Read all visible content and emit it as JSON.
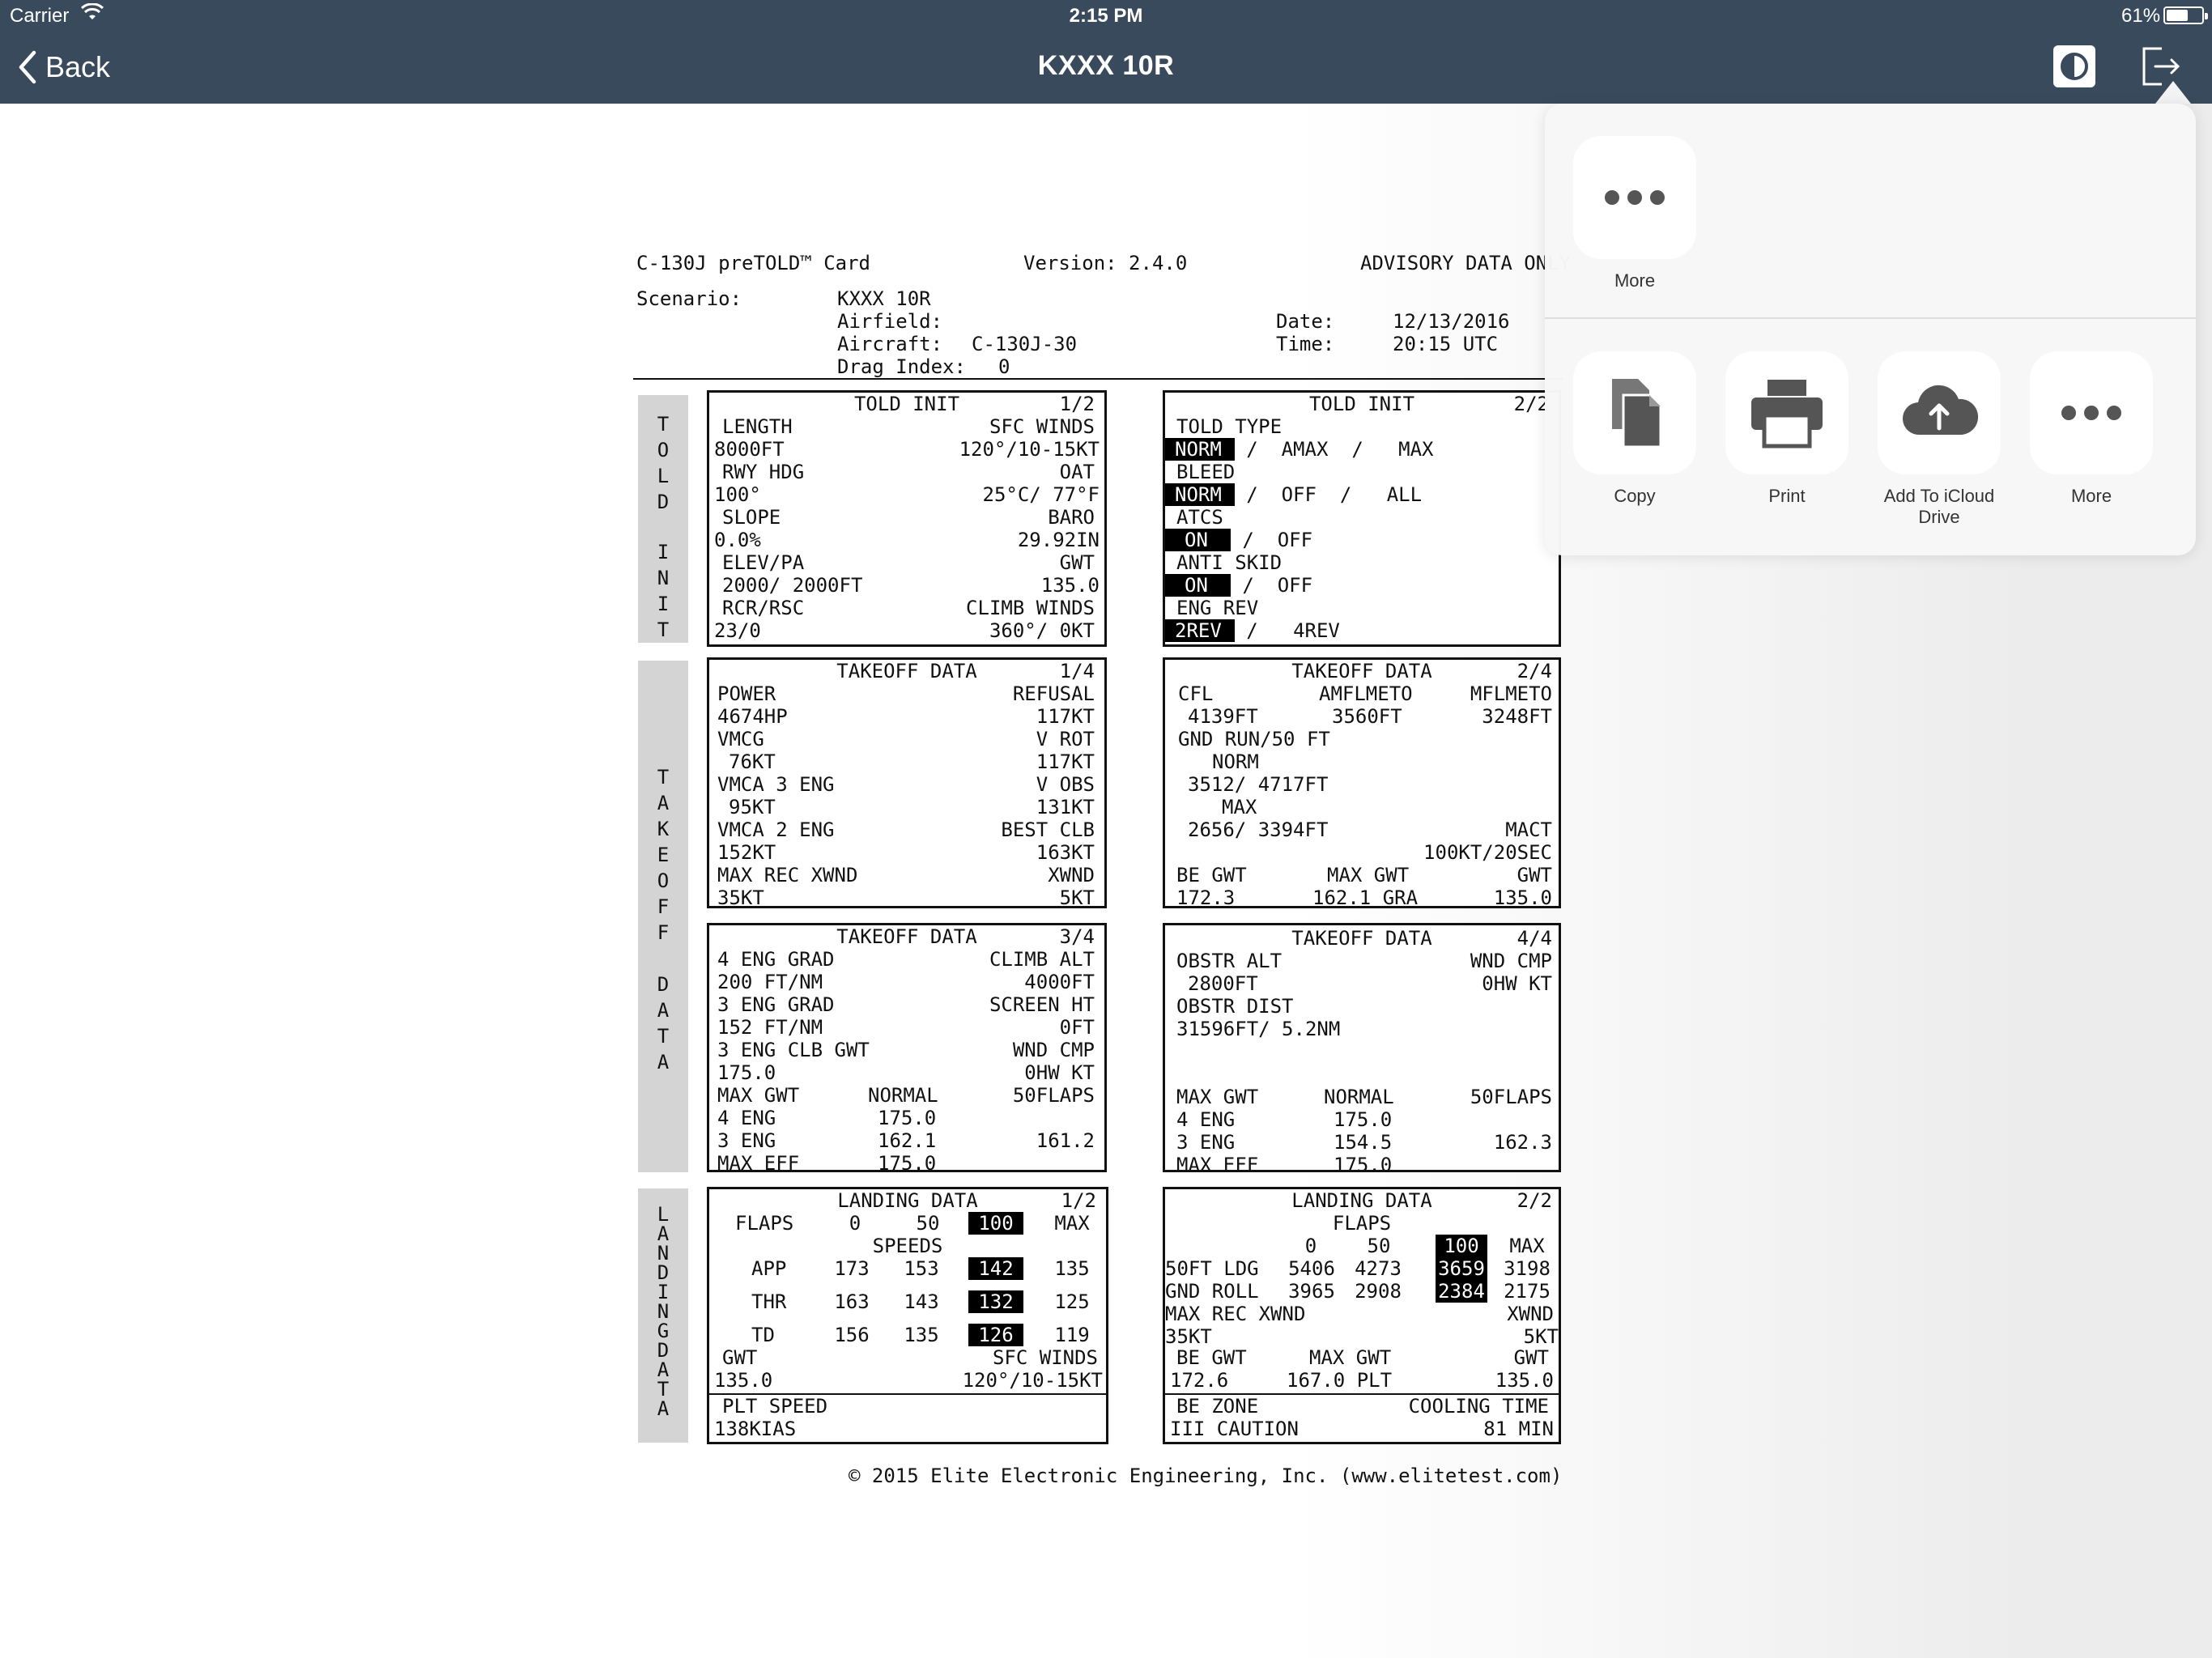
{
  "status_bar": {
    "carrier": "Carrier",
    "time": "2:15 PM",
    "battery": "61%",
    "battery_level": 0.61
  },
  "nav": {
    "back_label": "Back",
    "title": "KXXX 10R"
  },
  "doc": {
    "header": {
      "card_title": "C-130J preTOLD™ Card",
      "version": "Version: 2.4.0",
      "advisory": "ADVISORY DATA ONLY",
      "scenario_label": "Scenario:",
      "scenario_value": "KXXX 10R",
      "airfield_label": "Airfield:",
      "aircraft_label": "Aircraft:",
      "aircraft_value": "C-130J-30",
      "drag_label": "Drag Index:",
      "drag_value": "0",
      "date_label": "Date:",
      "date_value": "12/13/2016",
      "time_label": "Time:",
      "time_value": "20:15 UTC"
    },
    "side_tabs": {
      "told_init": [
        "T",
        "O",
        "L",
        "D",
        "",
        "I",
        "N",
        "I",
        "T"
      ],
      "takeoff": [
        "T",
        "A",
        "K",
        "E",
        "O",
        "F",
        "F",
        "",
        "D",
        "A",
        "T",
        "A"
      ],
      "landing": [
        "L",
        "A",
        "N",
        "D",
        "I",
        "N",
        "G",
        "D",
        "A",
        "T",
        "A"
      ]
    },
    "told_init_1": {
      "title": "TOLD INIT",
      "page": "1/2",
      "length_label": "LENGTH",
      "length": "8000FT",
      "sfc_winds_label": "SFC WINDS",
      "sfc_winds": "120°/10-15KT",
      "rwy_hdg_label": "RWY HDG",
      "rwy_hdg": "100°",
      "oat_label": "OAT",
      "oat": "25°C/ 77°F",
      "slope_label": "SLOPE",
      "slope": "0.0%",
      "baro_label": "BARO",
      "baro": "29.92IN",
      "elev_label": "ELEV/PA",
      "elev": "2000/ 2000FT",
      "gwt_label": "GWT",
      "gwt": "135.0",
      "rcr_label": "RCR/RSC",
      "rcr": "23/0",
      "climb_winds_label": "CLIMB WINDS",
      "climb_winds": "360°/ 0KT"
    },
    "told_init_2": {
      "title": "TOLD INIT",
      "page": "2/2",
      "told_type_label": "TOLD TYPE",
      "told_type": [
        "NORM",
        "/",
        "AMAX",
        "/",
        "MAX"
      ],
      "bleed_label": "BLEED",
      "bleed": [
        "NORM",
        "/",
        "OFF",
        "/",
        "ALL"
      ],
      "atcs_label": "ATCS",
      "atcs": [
        "ON",
        "/",
        "OFF"
      ],
      "anti_skid_label": "ANTI SKID",
      "anti_skid": [
        "ON",
        "/",
        "OFF"
      ],
      "eng_rev_label": "ENG REV",
      "eng_rev": [
        "2REV",
        "/",
        "4REV"
      ]
    },
    "takeoff_1": {
      "title": "TAKEOFF DATA",
      "page": "1/4",
      "power_label": "POWER",
      "power": "4674HP",
      "refusal_label": "REFUSAL",
      "refusal": "117KT",
      "vmcg_label": "VMCG",
      "vmcg": "76KT",
      "vrot_label": "V ROT",
      "vrot": "117KT",
      "vmca3_label": "VMCA 3 ENG",
      "vmca3": "95KT",
      "vobs_label": "V OBS",
      "vobs": "131KT",
      "vmca2_label": "VMCA 2 ENG",
      "vmca2": "152KT",
      "best_clb_label": "BEST CLB",
      "best_clb": "163KT",
      "max_rec_xwnd_label": "MAX REC XWND",
      "max_rec_xwnd": "35KT",
      "xwnd_label": "XWND",
      "xwnd": "5KT"
    },
    "takeoff_2": {
      "title": "TAKEOFF DATA",
      "page": "2/4",
      "cfl_label": "CFL",
      "cfl": "4139FT",
      "amflmeto_label": "AMFLMETO",
      "amflmeto": "3560FT",
      "mflmeto_label": "MFLMETO",
      "mflmeto": "3248FT",
      "gnd_run_label": "GND RUN/50 FT",
      "norm_label": "NORM",
      "norm": "3512/ 4717FT",
      "max_label": "MAX",
      "max": "2656/ 3394FT",
      "mact_label": "MACT",
      "mact": "100KT/20SEC",
      "be_gwt_label": "BE GWT",
      "be_gwt": "172.3",
      "max_gwt_label": "MAX GWT",
      "max_gwt": "162.1 GRA",
      "gwt_label": "GWT",
      "gwt": "135.0"
    },
    "takeoff_3": {
      "title": "TAKEOFF DATA",
      "page": "3/4",
      "eng4_grad_label": "4 ENG GRAD",
      "eng4_grad": "200 FT/NM",
      "climb_alt_label": "CLIMB ALT",
      "climb_alt": "4000FT",
      "eng3_grad_label": "3 ENG GRAD",
      "eng3_grad": "152 FT/NM",
      "screen_ht_label": "SCREEN HT",
      "screen_ht": "0FT",
      "eng3_clb_label": "3 ENG CLB GWT",
      "eng3_clb": "175.0",
      "wnd_cmp_label": "WND CMP",
      "wnd_cmp": "0HW KT",
      "max_gwt_label": "MAX GWT",
      "normal_label": "NORMAL",
      "flaps50_label": "50FLAPS",
      "rows": [
        {
          "label": "4 ENG",
          "normal": "175.0",
          "flaps50": ""
        },
        {
          "label": "3 ENG",
          "normal": "162.1",
          "flaps50": "161.2"
        },
        {
          "label": "MAX EFF",
          "normal": "175.0",
          "flaps50": ""
        }
      ]
    },
    "takeoff_4": {
      "title": "TAKEOFF DATA",
      "page": "4/4",
      "obstr_alt_label": "OBSTR ALT",
      "obstr_alt": "2800FT",
      "wnd_cmp_label": "WND CMP",
      "wnd_cmp": "0HW KT",
      "obstr_dist_label": "OBSTR DIST",
      "obstr_dist": "31596FT/ 5.2NM",
      "max_gwt_label": "MAX GWT",
      "normal_label": "NORMAL",
      "flaps50_label": "50FLAPS",
      "rows": [
        {
          "label": "4 ENG",
          "normal": "175.0",
          "flaps50": ""
        },
        {
          "label": "3 ENG",
          "normal": "154.5",
          "flaps50": "162.3"
        },
        {
          "label": "MAX EFF",
          "normal": "175.0",
          "flaps50": ""
        }
      ]
    },
    "landing_1": {
      "title": "LANDING DATA",
      "page": "1/2",
      "flaps_label": "FLAPS",
      "flaps": [
        "0",
        "50",
        "100",
        "MAX"
      ],
      "speeds_label": "SPEEDS",
      "rows": [
        {
          "label": "APP",
          "values": [
            "173",
            "153",
            "142",
            "135"
          ]
        },
        {
          "label": "THR",
          "values": [
            "163",
            "143",
            "132",
            "125"
          ]
        },
        {
          "label": "TD",
          "values": [
            "156",
            "135",
            "126",
            "119"
          ]
        }
      ],
      "gwt_label": "GWT",
      "gwt": "135.0",
      "sfc_winds_label": "SFC WINDS",
      "sfc_winds": "120°/10-15KT",
      "plt_speed_label": "PLT SPEED",
      "plt_speed": "138KIAS"
    },
    "landing_2": {
      "title": "LANDING DATA",
      "page": "2/2",
      "flaps_label": "FLAPS",
      "flaps": [
        "0",
        "50",
        "100",
        "MAX"
      ],
      "rows": [
        {
          "label": "50FT LDG",
          "values": [
            "5406",
            "4273",
            "3659",
            "3198"
          ]
        },
        {
          "label": "GND ROLL",
          "values": [
            "3965",
            "2908",
            "2384",
            "2175"
          ]
        }
      ],
      "max_rec_xwnd_label": "MAX REC XWND",
      "max_rec_xwnd": "35KT",
      "xwnd_label": "XWND",
      "xwnd": "5KT",
      "be_gwt_label": "BE GWT",
      "be_gwt": "172.6",
      "max_gwt_label": "MAX GWT",
      "max_gwt": "167.0 PLT",
      "gwt_label": "GWT",
      "gwt": "135.0",
      "be_zone_label": "BE ZONE",
      "be_zone": "III CAUTION",
      "cooling_label": "COOLING TIME",
      "cooling": "81 MIN"
    },
    "footer": "© 2015 Elite Electronic Engineering, Inc. (www.elitetest.com)"
  },
  "share_sheet": {
    "top_row": [
      {
        "label": "More",
        "icon": "more-icon"
      }
    ],
    "bottom_row": [
      {
        "label": "Copy",
        "icon": "copy-icon"
      },
      {
        "label": "Print",
        "icon": "print-icon"
      },
      {
        "label": "Add To iCloud\nDrive",
        "icon": "icloud-upload-icon"
      },
      {
        "label": "More",
        "icon": "more-icon"
      }
    ]
  },
  "colors": {
    "nav_bar": "#3a4a5d",
    "side_tab": "#d4d4d4",
    "share_sheet": "#f7f7f7"
  }
}
